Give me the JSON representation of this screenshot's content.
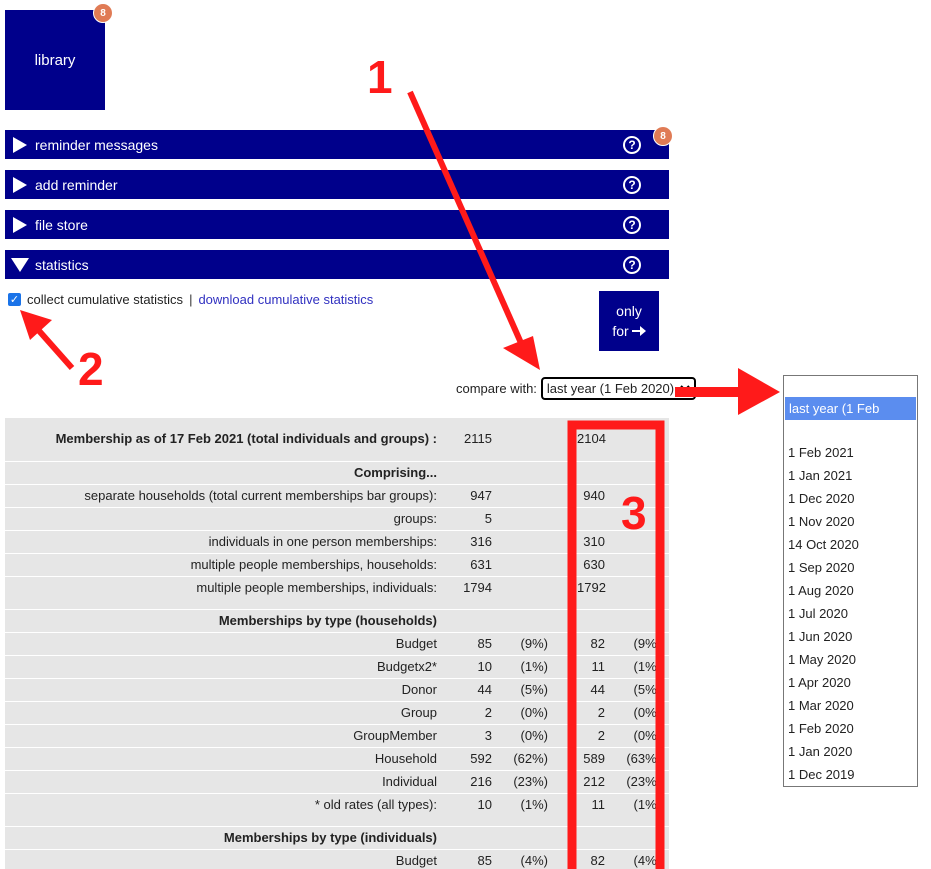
{
  "library": {
    "label": "library",
    "badge": "8"
  },
  "sections": [
    {
      "label": "reminder messages",
      "badge": "8",
      "expanded": false
    },
    {
      "label": "add reminder",
      "expanded": false
    },
    {
      "label": "file store",
      "expanded": false
    },
    {
      "label": "statistics",
      "expanded": true
    }
  ],
  "help_glyph": "?",
  "checkbox": {
    "label": "collect cumulative statistics",
    "checked": true
  },
  "separator": "|",
  "download_link": "download cumulative statistics",
  "only_button": {
    "line1": "only",
    "line2": "for"
  },
  "compare": {
    "label": "compare with:",
    "selected": "last year (1 Feb 2020)"
  },
  "stats": {
    "rows": [
      {
        "label": "Membership as of 17 Feb 2021 (total individuals and groups) :",
        "bold": true,
        "v1": "2115",
        "p1": "",
        "v2": "2104",
        "p2": ""
      },
      {
        "label": "Comprising...",
        "bold": true,
        "v1": "",
        "p1": "",
        "v2": "",
        "p2": ""
      },
      {
        "label": "separate households (total current memberships bar groups):",
        "v1": "947",
        "p1": "",
        "v2": "940",
        "p2": ""
      },
      {
        "label": "groups:",
        "v1": "5",
        "p1": "",
        "v2": "",
        "p2": ""
      },
      {
        "label": "individuals in one person memberships:",
        "v1": "316",
        "p1": "",
        "v2": "310",
        "p2": ""
      },
      {
        "label": "multiple people memberships, households:",
        "v1": "631",
        "p1": "",
        "v2": "630",
        "p2": ""
      },
      {
        "label": "multiple people memberships, individuals:",
        "v1": "1794",
        "p1": "",
        "v2": "1792",
        "p2": ""
      },
      {
        "label": "Memberships by type (households)",
        "bold": true,
        "v1": "",
        "p1": "",
        "v2": "",
        "p2": ""
      },
      {
        "label": "Budget",
        "v1": "85",
        "p1": "(9%)",
        "v2": "82",
        "p2": "(9%)"
      },
      {
        "label": "Budgetx2*",
        "v1": "10",
        "p1": "(1%)",
        "v2": "11",
        "p2": "(1%)"
      },
      {
        "label": "Donor",
        "v1": "44",
        "p1": "(5%)",
        "v2": "44",
        "p2": "(5%)"
      },
      {
        "label": "Group",
        "v1": "2",
        "p1": "(0%)",
        "v2": "2",
        "p2": "(0%)"
      },
      {
        "label": "GroupMember",
        "v1": "3",
        "p1": "(0%)",
        "v2": "2",
        "p2": "(0%)"
      },
      {
        "label": "Household",
        "v1": "592",
        "p1": "(62%)",
        "v2": "589",
        "p2": "(63%)"
      },
      {
        "label": "Individual",
        "v1": "216",
        "p1": "(23%)",
        "v2": "212",
        "p2": "(23%)"
      },
      {
        "label": "* old rates (all types):",
        "v1": "10",
        "p1": "(1%)",
        "v2": "11",
        "p2": "(1%)"
      },
      {
        "label": "Memberships by type (individuals)",
        "bold": true,
        "v1": "",
        "p1": "",
        "v2": "",
        "p2": ""
      },
      {
        "label": "Budget",
        "v1": "85",
        "p1": "(4%)",
        "v2": "82",
        "p2": "(4%)"
      }
    ]
  },
  "dropdown": {
    "selected": "last year (1 Feb 2020)",
    "options": [
      "1 Feb 2021",
      "1 Jan 2021",
      "1 Dec 2020",
      "1 Nov 2020",
      "14 Oct 2020",
      "1 Sep 2020",
      "1 Aug 2020",
      "1 Jul 2020",
      "1 Jun 2020",
      "1 May 2020",
      "1 Apr 2020",
      "1 Mar 2020",
      "1 Feb 2020",
      "1 Jan 2020",
      "1 Dec 2019"
    ]
  },
  "annotations": {
    "one": "1",
    "two": "2",
    "three": "3",
    "color": "#ff1a1a"
  },
  "colors": {
    "navy": "#00008b",
    "badge": "#e07b55",
    "highlight": "#5b8def",
    "table_bg": "#e6e6e6"
  }
}
